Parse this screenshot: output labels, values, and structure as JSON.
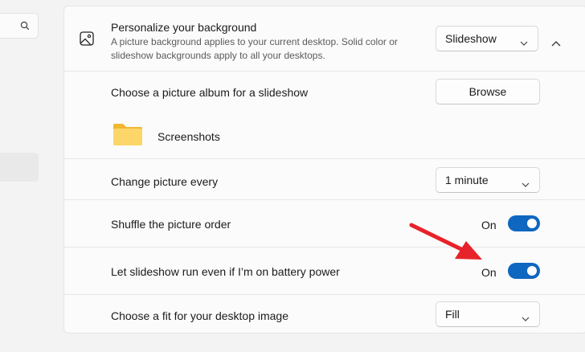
{
  "sidebar": {
    "search_icon": "search-icon"
  },
  "header": {
    "icon": "picture-icon",
    "title": "Personalize your background",
    "description": "A picture background applies to your current desktop. Solid color or slideshow backgrounds apply to all your desktops.",
    "dropdown_value": "Slideshow",
    "collapse_icon": "chevron-up-icon"
  },
  "album": {
    "label": "Choose a picture album for a slideshow",
    "button_label": "Browse",
    "folder_name": "Screenshots",
    "folder_icon": "folder-icon"
  },
  "interval": {
    "label": "Change picture every",
    "value": "1 minute"
  },
  "shuffle": {
    "label": "Shuffle the picture order",
    "state_text": "On",
    "enabled": true
  },
  "battery": {
    "label": "Let slideshow run even if I’m on battery power",
    "state_text": "On",
    "enabled": true
  },
  "fit": {
    "label": "Choose a fit for your desktop image",
    "value": "Fill"
  },
  "colors": {
    "accent": "#0f67c0",
    "annotation_arrow": "#e8222a",
    "background": "#f3f3f3",
    "card": "#fbfbfb"
  }
}
